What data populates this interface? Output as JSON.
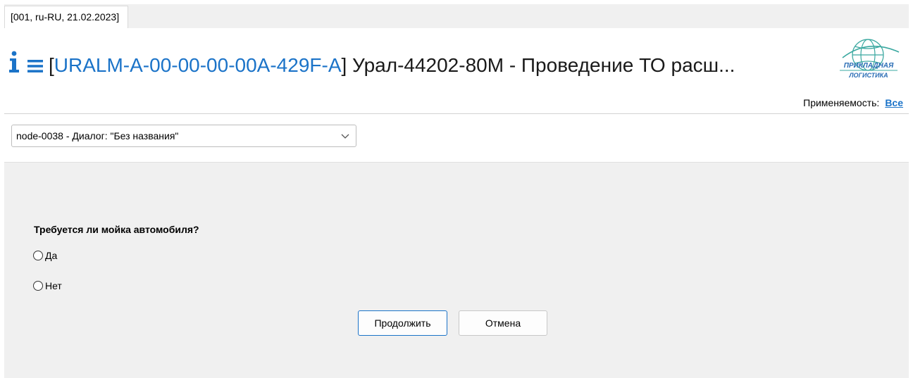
{
  "tab": {
    "label": "[001, ru-RU, 21.02.2023]"
  },
  "header": {
    "bracket_open": "[",
    "code": "URALM-A-00-00-00-00A-429F-A",
    "bracket_close": "]",
    "title_rest": " Урал-44202-80М - Проведение ТО расш...",
    "logo": {
      "line1": "ПРИКЛАДНАЯ",
      "line2": "ЛОГИСТИКА"
    },
    "applicability_label": "Применяемость:",
    "applicability_value": "Все",
    "accent_color": "#1b73c8"
  },
  "node_select": {
    "value": "node-0038 - Диалог: \"Без названия\""
  },
  "dialog": {
    "question": "Требуется ли мойка автомобиля?",
    "options": [
      {
        "label": "Да",
        "selected": false
      },
      {
        "label": "Нет",
        "selected": false
      }
    ],
    "continue_label": "Продолжить",
    "cancel_label": "Отмена"
  }
}
